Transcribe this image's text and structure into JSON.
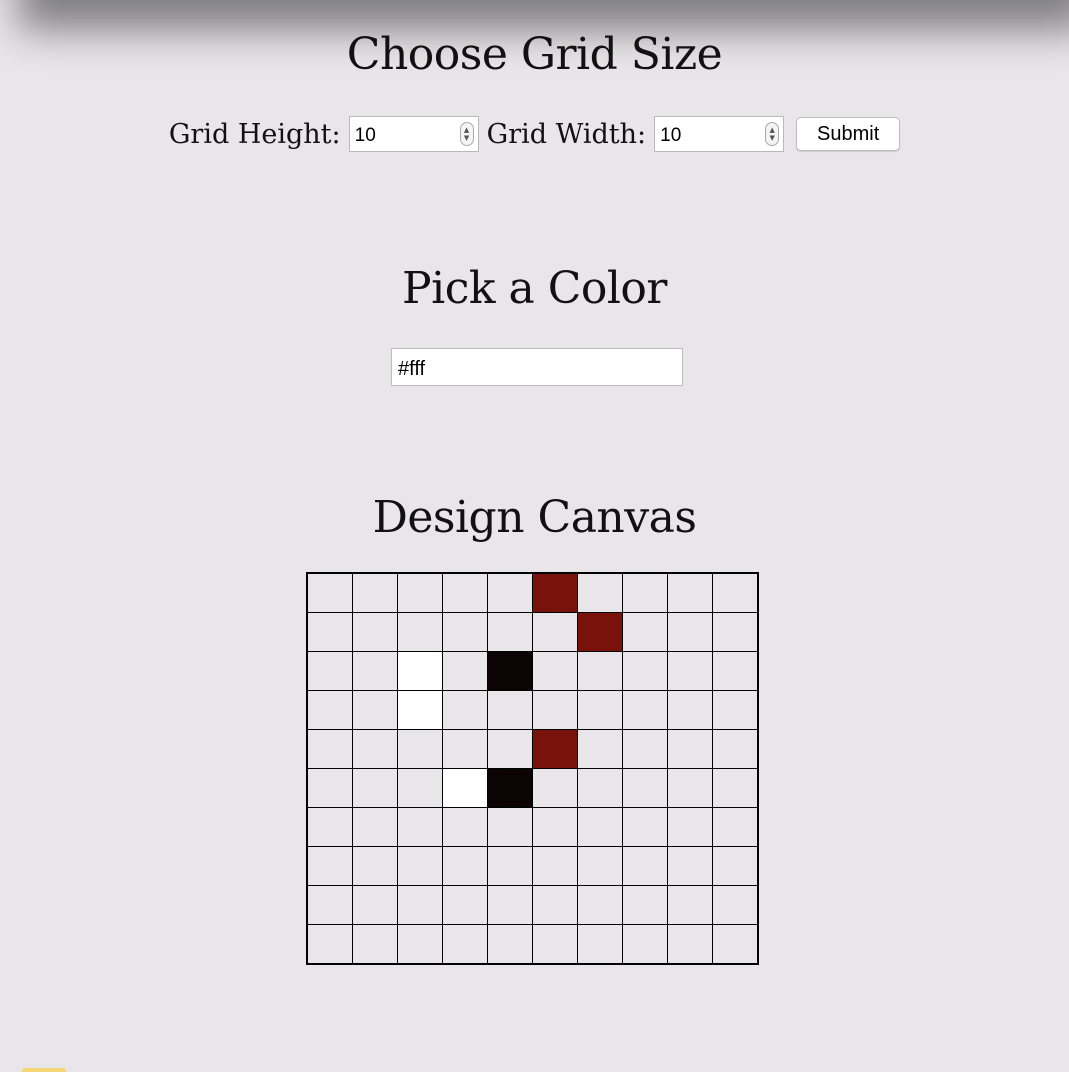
{
  "grid_size": {
    "title": "Choose Grid Size",
    "height_label": "Grid Height:",
    "height_value": "10",
    "width_label": "Grid Width:",
    "width_value": "10",
    "submit_label": "Submit"
  },
  "color_picker": {
    "title": "Pick a Color",
    "value": "#fff"
  },
  "canvas": {
    "title": "Design Canvas",
    "rows": 10,
    "cols": 10,
    "default_color": "#e8e6e9",
    "colored_cells": [
      {
        "row": 0,
        "col": 5,
        "color": "#7a120c"
      },
      {
        "row": 1,
        "col": 6,
        "color": "#7a120c"
      },
      {
        "row": 2,
        "col": 2,
        "color": "#ffffff"
      },
      {
        "row": 2,
        "col": 4,
        "color": "#0b0304"
      },
      {
        "row": 3,
        "col": 2,
        "color": "#ffffff"
      },
      {
        "row": 4,
        "col": 5,
        "color": "#7a120c"
      },
      {
        "row": 5,
        "col": 3,
        "color": "#ffffff"
      },
      {
        "row": 5,
        "col": 4,
        "color": "#0b0304"
      }
    ]
  },
  "icons": {
    "spinner": "stepper-arrows-icon"
  },
  "colors": {
    "background": "#e8e6e9",
    "dark_red": "#7a120c",
    "black": "#0b0304",
    "white": "#ffffff"
  }
}
